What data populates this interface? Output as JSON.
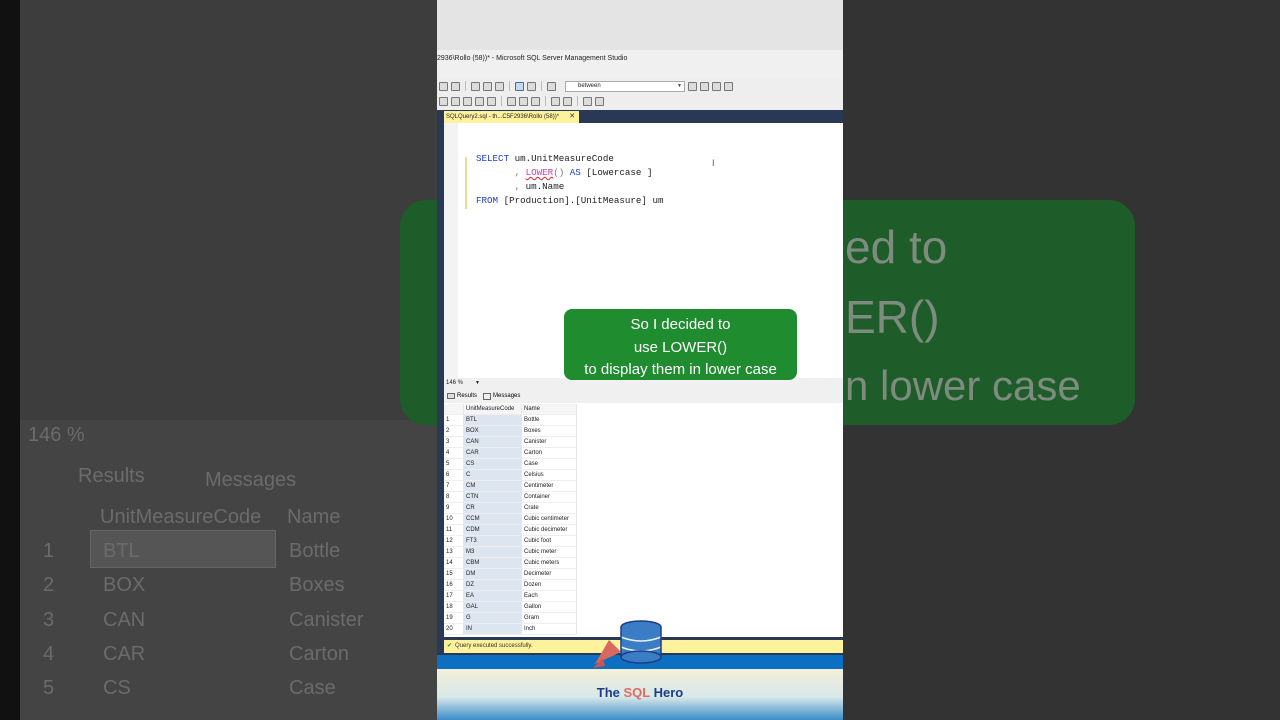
{
  "background": {
    "ghost_caption": [
      "ed to",
      "ER()",
      "n lower case"
    ],
    "ghost_zoom": "146 %",
    "ghost_tabs": {
      "results": "Results",
      "messages": "Messages"
    },
    "ghost_headers": {
      "code": "UnitMeasureCode",
      "name": "Name"
    },
    "ghost_rows": [
      {
        "num": "1",
        "code": "BTL",
        "name": "Bottle"
      },
      {
        "num": "2",
        "code": "BOX",
        "name": "Boxes"
      },
      {
        "num": "3",
        "code": "CAN",
        "name": "Canister"
      },
      {
        "num": "4",
        "code": "CAR",
        "name": "Carton"
      },
      {
        "num": "5",
        "code": "CS",
        "name": "Case"
      }
    ]
  },
  "window": {
    "title": "2936\\Rollo (58))* - Microsoft SQL Server Management Studio"
  },
  "toolbar": {
    "search_value": "between"
  },
  "editor_tab": {
    "label": "SQLQuery2.sql - th...C5F2936\\Rollo (58))*",
    "close": "✕"
  },
  "editor": {
    "line1_kw": "SELECT",
    "line1_rest": " um.UnitMeasureCode",
    "line2_comma": "       , ",
    "line2_fn": "LOWER",
    "line2_paren": "()",
    "line2_as": " AS ",
    "line2_alias": "[Lowercase ]",
    "line3_comma": "       , ",
    "line3_rest": "um.Name",
    "line4_kw": "FROM",
    "line4_rest": " [Production].[UnitMeasure] um"
  },
  "zoom": "146 %",
  "results_tabs": {
    "results": "Results",
    "messages": "Messages"
  },
  "results": {
    "headers": {
      "code": "UnitMeasureCode",
      "name": "Name"
    },
    "rows": [
      {
        "num": "1",
        "code": "BTL",
        "name": "Bottle"
      },
      {
        "num": "2",
        "code": "BOX",
        "name": "Boxes"
      },
      {
        "num": "3",
        "code": "CAN",
        "name": "Canister"
      },
      {
        "num": "4",
        "code": "CAR",
        "name": "Carton"
      },
      {
        "num": "5",
        "code": "CS",
        "name": "Case"
      },
      {
        "num": "6",
        "code": "C",
        "name": "Celsius"
      },
      {
        "num": "7",
        "code": "CM",
        "name": "Centimeter"
      },
      {
        "num": "8",
        "code": "CTN",
        "name": "Container"
      },
      {
        "num": "9",
        "code": "CR",
        "name": "Crate"
      },
      {
        "num": "10",
        "code": "CCM",
        "name": "Cubic centimeter"
      },
      {
        "num": "11",
        "code": "CDM",
        "name": "Cubic decimeter"
      },
      {
        "num": "12",
        "code": "FT3",
        "name": "Cubic foot"
      },
      {
        "num": "13",
        "code": "M3",
        "name": "Cubic meter"
      },
      {
        "num": "14",
        "code": "CBM",
        "name": "Cubic meters"
      },
      {
        "num": "15",
        "code": "DM",
        "name": "Decimeter"
      },
      {
        "num": "16",
        "code": "DZ",
        "name": "Dozen"
      },
      {
        "num": "17",
        "code": "EA",
        "name": "Each"
      },
      {
        "num": "18",
        "code": "GAL",
        "name": "Gallon"
      },
      {
        "num": "19",
        "code": "G",
        "name": "Gram"
      },
      {
        "num": "20",
        "code": "IN",
        "name": "Inch"
      }
    ]
  },
  "status": "Query executed successfully.",
  "caption": [
    "So I decided to",
    "use LOWER()",
    "to display them in lower case"
  ],
  "logo": {
    "part1": "The ",
    "part2": "SQL",
    "part3": " Hero"
  },
  "colors": {
    "caption_bg": "#1f8c2f",
    "tab_bg": "#fff29d",
    "keyword": "#1d3fc7",
    "function": "#c63fb5"
  }
}
